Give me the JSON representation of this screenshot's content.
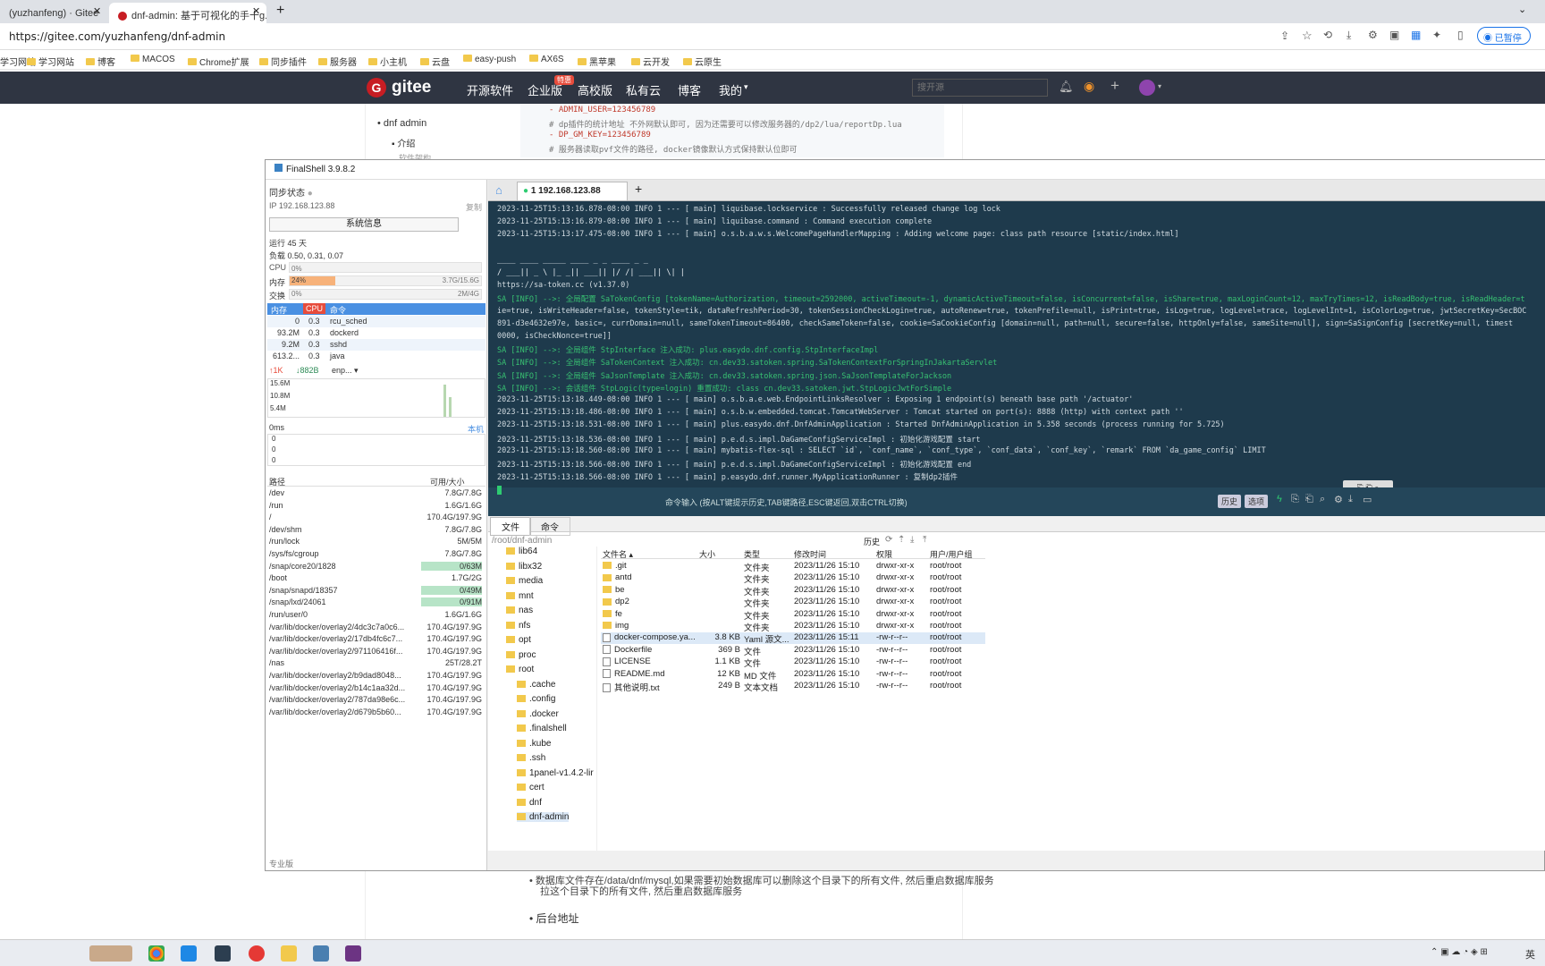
{
  "browser": {
    "tabs": [
      {
        "title": "(yuzhanfeng) · Gitee"
      },
      {
        "title": "dnf-admin: 基于可视化的手十g..."
      }
    ],
    "new_tab": "+",
    "url": "https://gitee.com/yuzhanfeng/dnf-admin",
    "profile_label": "已暂停"
  },
  "bookmarks": [
    "学习网站",
    "学习网站",
    "博客",
    "MACOS",
    "Chrome扩展",
    "同步插件",
    "服务器",
    "小主机",
    "云盘",
    "easy-push",
    "AX6S",
    "黑苹果",
    "云开发",
    "云原生"
  ],
  "gitee": {
    "logo": "gitee",
    "nav": [
      "开源软件",
      "企业版",
      "高校版",
      "私有云",
      "博客",
      "我的"
    ],
    "badge": "特惠",
    "search_placeholder": "搜开源"
  },
  "page": {
    "toc": [
      "dnf admin",
      "介绍",
      "软件架构"
    ],
    "code_lines": [
      "- ADMIN_USER=123456789",
      "# dp插件的统计地址 不外网默认即可, 因为还需要可以修改服务器的/dp2/lua/reportDp.lua",
      "- DP_GM_KEY=123456789",
      "# 服务器读取pvf文件的路径, docker镜像默认方式保持默认位即可"
    ],
    "bottom_text_1": "数据库文件存在/data/dnf/mysql,如果需要初始数据库可以删除这个目录下的所有文件, 然后重启数据库服务",
    "bottom_text_2": "拉这个目录下的所有文件, 然后重启数据库服务",
    "bullet_backend": "后台地址"
  },
  "finalshell": {
    "title": "FinalShell 3.9.8.2",
    "sync_label": "同步状态",
    "ip": "IP 192.168.123.88",
    "copy_label": "复制",
    "sysinfo_btn": "系统信息",
    "uptime": "运行 45 天",
    "load": "负载 0.50, 0.31, 0.07",
    "cpu_label": "CPU",
    "cpu_val": "0%",
    "mem_label": "内存",
    "mem_pct": "24%",
    "mem_val": "3.7G/15.6G",
    "mem_fraction": 0.24,
    "swap_label": "交换",
    "swap_pct": "0%",
    "swap_val": "2M/4G",
    "proc_headers": [
      "内存",
      "CPU",
      "命令"
    ],
    "processes": [
      {
        "mem": "0",
        "cpu": "0.3",
        "cmd": "rcu_sched"
      },
      {
        "mem": "93.2M",
        "cpu": "0.3",
        "cmd": "dockerd"
      },
      {
        "mem": "9.2M",
        "cpu": "0.3",
        "cmd": "sshd"
      },
      {
        "mem": "613.2...",
        "cpu": "0.3",
        "cmd": "java"
      }
    ],
    "net_up": "↑1K",
    "net_down": "↓882B",
    "net_iface": "enp...",
    "net_scale": [
      "15.6M",
      "10.8M",
      "5.4M"
    ],
    "ping_label": "0ms",
    "ping_host": "本机",
    "ping_scale": [
      "0",
      "0",
      "0"
    ],
    "disk_headers": [
      "路径",
      "可用/大小"
    ],
    "disks": [
      {
        "path": "/dev",
        "size": "7.8G/7.8G"
      },
      {
        "path": "/run",
        "size": "1.6G/1.6G"
      },
      {
        "path": "/",
        "size": "170.4G/197.9G"
      },
      {
        "path": "/dev/shm",
        "size": "7.8G/7.8G"
      },
      {
        "path": "/run/lock",
        "size": "5M/5M"
      },
      {
        "path": "/sys/fs/cgroup",
        "size": "7.8G/7.8G"
      },
      {
        "path": "/snap/core20/1828",
        "size": "0/63M"
      },
      {
        "path": "/boot",
        "size": "1.7G/2G"
      },
      {
        "path": "/snap/snapd/18357",
        "size": "0/49M"
      },
      {
        "path": "/snap/lxd/24061",
        "size": "0/91M"
      },
      {
        "path": "/run/user/0",
        "size": "1.6G/1.6G"
      },
      {
        "path": "/var/lib/docker/overlay2/4dc3c7a0c6...",
        "size": "170.4G/197.9G"
      },
      {
        "path": "/var/lib/docker/overlay2/17db4fc6c7...",
        "size": "170.4G/197.9G"
      },
      {
        "path": "/var/lib/docker/overlay2/971106416f...",
        "size": "170.4G/197.9G"
      },
      {
        "path": "/nas",
        "size": "25T/28.2T"
      },
      {
        "path": "/var/lib/docker/overlay2/b9dad8048...",
        "size": "170.4G/197.9G"
      },
      {
        "path": "/var/lib/docker/overlay2/b14c1aa32d...",
        "size": "170.4G/197.9G"
      },
      {
        "path": "/var/lib/docker/overlay2/787da98e6c...",
        "size": "170.4G/197.9G"
      },
      {
        "path": "/var/lib/docker/overlay2/d679b5b60...",
        "size": "170.4G/197.9G"
      }
    ],
    "edition": "专业版",
    "session_tab": "1 192.168.123.88",
    "terminal_lines": [
      "2023-11-25T15:13:16.878-08:00  INFO 1 --- [           main] liquibase.lockservice                    : Successfully released change log lock",
      "2023-11-25T15:13:16.879-08:00  INFO 1 --- [           main] liquibase.command                        : Command execution complete",
      "2023-11-25T15:13:17.475-08:00  INFO 1 --- [           main] o.s.b.a.w.s.WelcomePageHandlerMapping    : Adding welcome page: class path resource [static/index.html]",
      "",
      " ____  ____    _____  ____  _  _  ____  _  _",
      "/ ___||  _ \\  |_   _|| ___|| |/ /| ___|| \\| |",
      "https://sa-token.cc (v1.37.0)",
      "SA [INFO] -->: 全局配置 SaTokenConfig [tokenName=Authorization, timeout=2592000, activeTimeout=-1, dynamicActiveTimeout=false, isConcurrent=false, isShare=true, maxLoginCount=12, maxTryTimes=12, isReadBody=true, isReadHeader=t",
      "ie=true, isWriteHeader=false, tokenStyle=tik, dataRefreshPeriod=30, tokenSessionCheckLogin=true, autoRenew=true, tokenPrefile=null, isPrint=true, isLog=true, logLevel=trace, logLevelInt=1, isColorLog=true, jwtSecretKey=SecBOC",
      "891-d3e4632e97e, basic=, currDomain=null, sameTokenTimeout=86400, checkSameToken=false, cookie=SaCookieConfig [domain=null, path=null, secure=false, httpOnly=false, sameSite=null], sign=SaSignConfig [secretKey=null, timest",
      "0000, isCheckNonce=true]]",
      "SA [INFO] -->: 全局组件 StpInterface 注入成功: plus.easydo.dnf.config.StpInterfaceImpl",
      "SA [INFO] -->: 全局组件 SaTokenContext 注入成功: cn.dev33.satoken.spring.SaTokenContextForSpringInJakartaServlet",
      "SA [INFO] -->: 全局组件 SaJsonTemplate 注入成功: cn.dev33.satoken.spring.json.SaJsonTemplateForJackson",
      "SA [INFO] -->: 会话组件 StpLogic(type=login) 重置成功: class cn.dev33.satoken.jwt.StpLogicJwtForSimple",
      "2023-11-25T15:13:18.449-08:00  INFO 1 --- [           main] o.s.b.a.e.web.EndpointLinksResolver      : Exposing 1 endpoint(s) beneath base path '/actuator'",
      "2023-11-25T15:13:18.486-08:00  INFO 1 --- [           main] o.s.b.w.embedded.tomcat.TomcatWebServer  : Tomcat started on port(s): 8888 (http) with context path ''",
      "2023-11-25T15:13:18.531-08:00  INFO 1 --- [           main] plus.easydo.dnf.DnfAdminApplication      : Started DnfAdminApplication in 5.358 seconds (process running for 5.725)",
      "2023-11-25T15:13:18.536-08:00  INFO 1 --- [           main] p.e.d.s.impl.DaGameConfigServiceImpl     : 初始化游戏配置 start",
      "2023-11-25T15:13:18.560-08:00  INFO 1 --- [           main] mybatis-flex-sql                         : SELECT `id`, `conf_name`, `conf_type`, `conf_data`, `conf_key`, `remark` FROM `da_game_config` LIMIT",
      "2023-11-25T15:13:18.566-08:00  INFO 1 --- [           main] p.e.d.s.impl.DaGameConfigServiceImpl     : 初始化游戏配置 end",
      "2023-11-25T15:13:18.566-08:00  INFO 1 --- [           main] p.easydo.dnf.runner.MyApplicationRunner  : 复制dp2插件"
    ],
    "cmd_hint": "命令输入 (按ALT键提示历史,TAB键路径,ESC键返回,双击CTRL切换)",
    "cmd_btn_history": "历史",
    "cmd_btn_options": "选项",
    "file_tabs": [
      "文件",
      "命令"
    ],
    "path": "/root/dnf-admin",
    "history_btn": "历史",
    "tree": [
      "lib64",
      "libx32",
      "media",
      "mnt",
      "nas",
      "nfs",
      "opt",
      "proc",
      "root",
      ".cache",
      ".config",
      ".docker",
      ".finalshell",
      ".kube",
      ".ssh",
      "1panel-v1.4.2-lir",
      "cert",
      "dnf",
      "dnf-admin"
    ],
    "file_headers": [
      "文件名",
      "大小",
      "类型",
      "修改时间",
      "权限",
      "用户/用户组"
    ],
    "files": [
      {
        "name": ".git",
        "size": "",
        "type": "文件夹",
        "time": "2023/11/26 15:10",
        "perm": "drwxr-xr-x",
        "owner": "root/root",
        "dir": true
      },
      {
        "name": "antd",
        "size": "",
        "type": "文件夹",
        "time": "2023/11/26 15:10",
        "perm": "drwxr-xr-x",
        "owner": "root/root",
        "dir": true
      },
      {
        "name": "be",
        "size": "",
        "type": "文件夹",
        "time": "2023/11/26 15:10",
        "perm": "drwxr-xr-x",
        "owner": "root/root",
        "dir": true
      },
      {
        "name": "dp2",
        "size": "",
        "type": "文件夹",
        "time": "2023/11/26 15:10",
        "perm": "drwxr-xr-x",
        "owner": "root/root",
        "dir": true
      },
      {
        "name": "fe",
        "size": "",
        "type": "文件夹",
        "time": "2023/11/26 15:10",
        "perm": "drwxr-xr-x",
        "owner": "root/root",
        "dir": true
      },
      {
        "name": "img",
        "size": "",
        "type": "文件夹",
        "time": "2023/11/26 15:10",
        "perm": "drwxr-xr-x",
        "owner": "root/root",
        "dir": true
      },
      {
        "name": "docker-compose.ya...",
        "size": "3.8 KB",
        "type": "Yaml 源文...",
        "time": "2023/11/26 15:11",
        "perm": "-rw-r--r--",
        "owner": "root/root",
        "dir": false
      },
      {
        "name": "Dockerfile",
        "size": "369 B",
        "type": "文件",
        "time": "2023/11/26 15:10",
        "perm": "-rw-r--r--",
        "owner": "root/root",
        "dir": false
      },
      {
        "name": "LICENSE",
        "size": "1.1 KB",
        "type": "文件",
        "time": "2023/11/26 15:10",
        "perm": "-rw-r--r--",
        "owner": "root/root",
        "dir": false
      },
      {
        "name": "README.md",
        "size": "12 KB",
        "type": "MD 文件",
        "time": "2023/11/26 15:10",
        "perm": "-rw-r--r--",
        "owner": "root/root",
        "dir": false
      },
      {
        "name": "其他说明.txt",
        "size": "249 B",
        "type": "文本文档",
        "time": "2023/11/26 15:10",
        "perm": "-rw-r--r--",
        "owner": "root/root",
        "dir": false
      }
    ]
  },
  "taskbar": {
    "tray_time": "英"
  }
}
